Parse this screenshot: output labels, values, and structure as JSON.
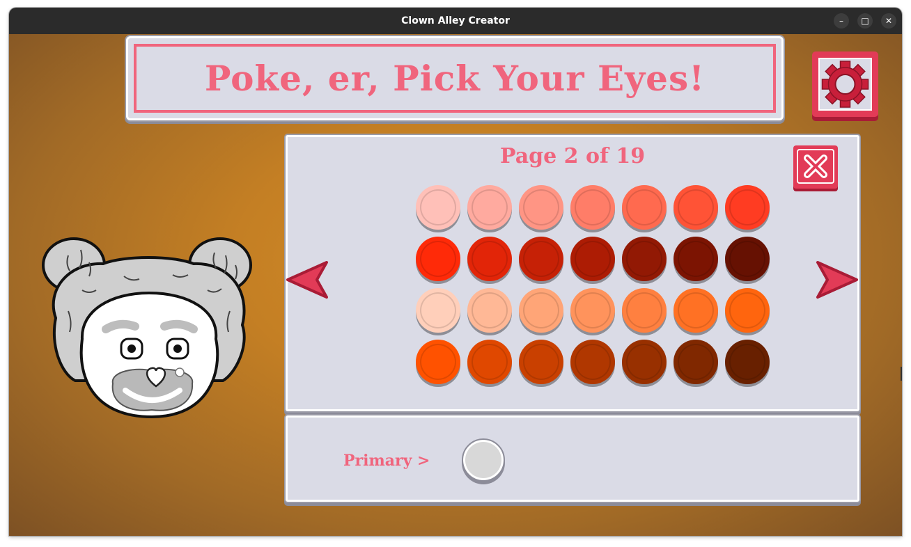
{
  "window": {
    "title": "Clown Alley Creator",
    "controls": {
      "minimize": "–",
      "maximize": "□",
      "close": "✕"
    }
  },
  "header": {
    "title": "Poke, er, Pick Your Eyes!"
  },
  "settings": {
    "icon": "gear-icon"
  },
  "picker": {
    "page_label": "Page 2 of 19",
    "close_icon": "close-x-icon",
    "prev_icon": "arrow-left-icon",
    "next_icon": "arrow-right-icon",
    "swatches": [
      [
        "#ffc0b8",
        "#ffaa9f",
        "#ff9584",
        "#ff7d68",
        "#ff6a4f",
        "#ff5336",
        "#ff3c22"
      ],
      [
        "#ff2a08",
        "#e22508",
        "#c62106",
        "#ad1c04",
        "#921904",
        "#7c1402",
        "#661102"
      ],
      [
        "#ffcfba",
        "#ffb896",
        "#ffa577",
        "#ff935c",
        "#ff8040",
        "#ff7124",
        "#ff650e"
      ],
      [
        "#ff5200",
        "#e04800",
        "#c94000",
        "#b03700",
        "#983000",
        "#802800",
        "#682000"
      ]
    ]
  },
  "selection": {
    "label": "Primary >",
    "value_color": "#d8d8d8"
  },
  "preview": {
    "name": "clown-face"
  }
}
